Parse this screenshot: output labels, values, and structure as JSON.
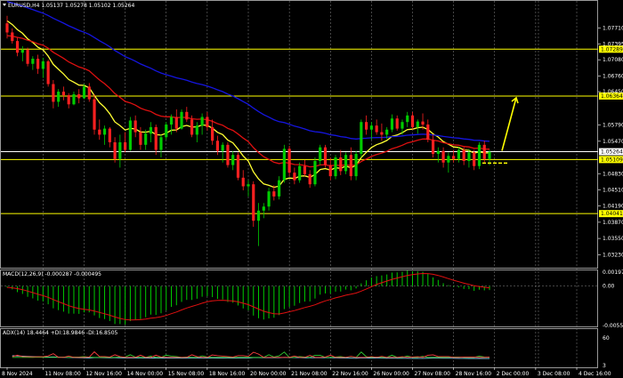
{
  "header": {
    "symbol_line": "EURUSD,H4  1.05137 1.05278 1.05102 1.05264"
  },
  "price_axis": [
    {
      "value": 1.0771,
      "label": "1.07710"
    },
    {
      "value": 1.07395,
      "label": "1.07395"
    },
    {
      "value": 1.0708,
      "label": "1.07080"
    },
    {
      "value": 1.0676,
      "label": "1.06760"
    },
    {
      "value": 1.0645,
      "label": "1.06450"
    },
    {
      "value": 1.0579,
      "label": "1.05790"
    },
    {
      "value": 1.0547,
      "label": "1.05470"
    },
    {
      "value": 1.0483,
      "label": "1.04830"
    },
    {
      "value": 1.0451,
      "label": "1.04510"
    },
    {
      "value": 1.0419,
      "label": "1.04190"
    },
    {
      "value": 1.0387,
      "label": "1.03870"
    },
    {
      "value": 1.0355,
      "label": "1.03550"
    },
    {
      "value": 1.0323,
      "label": "1.03230"
    }
  ],
  "levels": [
    {
      "value": 1.07289,
      "label": "1.07289",
      "color": "#ffff00"
    },
    {
      "value": 1.06364,
      "label": "1.06364",
      "color": "#ffff00"
    },
    {
      "value": 1.05264,
      "label": "1.05264",
      "color": "#ffffff"
    },
    {
      "value": 1.05109,
      "label": "1.05109",
      "color": "#ffff00"
    },
    {
      "value": 1.04041,
      "label": "1.04041",
      "color": "#ffff00"
    }
  ],
  "time_axis": [
    {
      "label": "8 Nov 2024",
      "x_index": 0
    },
    {
      "label": "11 Nov 08:00",
      "x_index": 7
    },
    {
      "label": "12 Nov 16:00",
      "x_index": 15
    },
    {
      "label": "14 Nov 00:00",
      "x_index": 23
    },
    {
      "label": "15 Nov 08:00",
      "x_index": 31
    },
    {
      "label": "18 Nov 16:00",
      "x_index": 39
    },
    {
      "label": "20 Nov 00:00",
      "x_index": 47
    },
    {
      "label": "21 Nov 08:00",
      "x_index": 55
    },
    {
      "label": "22 Nov 16:00",
      "x_index": 63
    },
    {
      "label": "26 Nov 00:00",
      "x_index": 71
    },
    {
      "label": "27 Nov 08:00",
      "x_index": 79
    },
    {
      "label": "28 Nov 16:00",
      "x_index": 87
    },
    {
      "label": "2 Dec 00:00",
      "x_index": 95
    },
    {
      "label": "3 Dec 08:00",
      "x_index": 103
    },
    {
      "label": "4 Dec 16:00",
      "x_index": 111
    }
  ],
  "macd": {
    "label": "MACD(12,26,9) -0.000287 -0.000495",
    "axis": [
      {
        "value": 0.001972,
        "label": "0.001972"
      },
      {
        "value": 0,
        "label": "0.00"
      },
      {
        "value": -0.005579,
        "label": "-0.005579"
      }
    ]
  },
  "adx": {
    "label": "ADX(14) 18.4464 +DI:18.9846 -DI:16.8505",
    "axis": [
      {
        "value": 60,
        "label": "60"
      },
      {
        "value": 3,
        "label": "3"
      }
    ]
  },
  "colors": {
    "bull": "#00cc00",
    "bear": "#ff2020",
    "ma_fast": "#ffff33",
    "ma_mid": "#e01010",
    "ma_slow": "#1515e0",
    "level": "#ffff00",
    "arrow": "#ffff00",
    "grid": "#8a8a8a"
  },
  "chart_data": {
    "type": "candlestick",
    "symbol": "EURUSD",
    "timeframe": "H4",
    "ylim": [
      1.0313,
      1.0805
    ],
    "candles": [
      [
        1.078,
        1.0795,
        1.075,
        1.0762
      ],
      [
        1.0762,
        1.077,
        1.074,
        1.0745
      ],
      [
        1.0745,
        1.0752,
        1.0715,
        1.0722
      ],
      [
        1.0722,
        1.0735,
        1.0705,
        1.0728
      ],
      [
        1.0728,
        1.0732,
        1.0695,
        1.07
      ],
      [
        1.07,
        1.0715,
        1.0688,
        1.071
      ],
      [
        1.071,
        1.0718,
        1.068,
        1.069
      ],
      [
        1.069,
        1.0712,
        1.0672,
        1.0705
      ],
      [
        1.0705,
        1.0708,
        1.0655,
        1.066
      ],
      [
        1.066,
        1.0668,
        1.0612,
        1.0625
      ],
      [
        1.0625,
        1.065,
        1.0615,
        1.0645
      ],
      [
        1.0645,
        1.0655,
        1.0628,
        1.0638
      ],
      [
        1.0638,
        1.0642,
        1.0612,
        1.062
      ],
      [
        1.062,
        1.0645,
        1.0618,
        1.064
      ],
      [
        1.064,
        1.065,
        1.0622,
        1.0632
      ],
      [
        1.0632,
        1.066,
        1.063,
        1.0655
      ],
      [
        1.0655,
        1.0662,
        1.0625,
        1.063
      ],
      [
        1.063,
        1.064,
        1.056,
        1.057
      ],
      [
        1.057,
        1.059,
        1.055,
        1.056
      ],
      [
        1.056,
        1.0578,
        1.054,
        1.0572
      ],
      [
        1.0572,
        1.0575,
        1.0535,
        1.0545
      ],
      [
        1.0545,
        1.0555,
        1.0505,
        1.0512
      ],
      [
        1.0512,
        1.056,
        1.0495,
        1.0545
      ],
      [
        1.0545,
        1.0565,
        1.0525,
        1.053
      ],
      [
        1.053,
        1.0595,
        1.0528,
        1.0588
      ],
      [
        1.0588,
        1.0598,
        1.0555,
        1.0565
      ],
      [
        1.0565,
        1.0575,
        1.053,
        1.054
      ],
      [
        1.054,
        1.057,
        1.053,
        1.0562
      ],
      [
        1.0562,
        1.0585,
        1.0545,
        1.0575
      ],
      [
        1.0575,
        1.058,
        1.052,
        1.053
      ],
      [
        1.053,
        1.056,
        1.0515,
        1.0555
      ],
      [
        1.0555,
        1.0585,
        1.055,
        1.058
      ],
      [
        1.058,
        1.06,
        1.056,
        1.0595
      ],
      [
        1.0595,
        1.061,
        1.0565,
        1.0572
      ],
      [
        1.0572,
        1.061,
        1.057,
        1.0605
      ],
      [
        1.0605,
        1.0615,
        1.0585,
        1.059
      ],
      [
        1.059,
        1.0598,
        1.0555,
        1.056
      ],
      [
        1.056,
        1.0585,
        1.0545,
        1.0578
      ],
      [
        1.0578,
        1.0602,
        1.056,
        1.0595
      ],
      [
        1.0595,
        1.0605,
        1.0568,
        1.0575
      ],
      [
        1.0575,
        1.059,
        1.054,
        1.0548
      ],
      [
        1.0548,
        1.0558,
        1.052,
        1.0528
      ],
      [
        1.0528,
        1.0545,
        1.0505,
        1.054
      ],
      [
        1.054,
        1.0545,
        1.0495,
        1.05
      ],
      [
        1.05,
        1.0528,
        1.049,
        1.052
      ],
      [
        1.052,
        1.0525,
        1.047,
        1.0475
      ],
      [
        1.0475,
        1.049,
        1.045,
        1.0458
      ],
      [
        1.0458,
        1.047,
        1.0438,
        1.0462
      ],
      [
        1.0462,
        1.0468,
        1.0378,
        1.039
      ],
      [
        1.039,
        1.0425,
        1.034,
        1.041
      ],
      [
        1.041,
        1.0425,
        1.0395,
        1.0418
      ],
      [
        1.0418,
        1.0455,
        1.041,
        1.0448
      ],
      [
        1.0448,
        1.046,
        1.043,
        1.0438
      ],
      [
        1.0438,
        1.0478,
        1.0432,
        1.047
      ],
      [
        1.047,
        1.054,
        1.0465,
        1.0532
      ],
      [
        1.0532,
        1.0538,
        1.0478,
        1.0485
      ],
      [
        1.0485,
        1.0495,
        1.0462,
        1.047
      ],
      [
        1.047,
        1.0505,
        1.0465,
        1.0498
      ],
      [
        1.0498,
        1.051,
        1.0478,
        1.0482
      ],
      [
        1.0482,
        1.049,
        1.0455,
        1.0462
      ],
      [
        1.0462,
        1.0515,
        1.0458,
        1.0508
      ],
      [
        1.0508,
        1.054,
        1.05,
        1.0535
      ],
      [
        1.0535,
        1.054,
        1.0495,
        1.05
      ],
      [
        1.05,
        1.0515,
        1.047,
        1.0478
      ],
      [
        1.0478,
        1.052,
        1.0472,
        1.0515
      ],
      [
        1.0515,
        1.053,
        1.048,
        1.0488
      ],
      [
        1.0488,
        1.0525,
        1.0482,
        1.052
      ],
      [
        1.052,
        1.0535,
        1.047,
        1.0478
      ],
      [
        1.0478,
        1.0528,
        1.047,
        1.0522
      ],
      [
        1.0522,
        1.059,
        1.0515,
        1.0585
      ],
      [
        1.0585,
        1.0598,
        1.056,
        1.057
      ],
      [
        1.057,
        1.0585,
        1.055,
        1.0578
      ],
      [
        1.0578,
        1.059,
        1.056,
        1.0565
      ],
      [
        1.0565,
        1.0582,
        1.0548,
        1.056
      ],
      [
        1.056,
        1.0575,
        1.0552,
        1.057
      ],
      [
        1.057,
        1.06,
        1.0565,
        1.0592
      ],
      [
        1.0592,
        1.0598,
        1.0568,
        1.0572
      ],
      [
        1.0572,
        1.059,
        1.056,
        1.0585
      ],
      [
        1.0585,
        1.0605,
        1.0575,
        1.0598
      ],
      [
        1.0598,
        1.0605,
        1.057,
        1.0575
      ],
      [
        1.0575,
        1.059,
        1.0562,
        1.0586
      ],
      [
        1.0586,
        1.0602,
        1.057,
        1.058
      ],
      [
        1.058,
        1.059,
        1.0545,
        1.055
      ],
      [
        1.055,
        1.056,
        1.0515,
        1.0522
      ],
      [
        1.0522,
        1.0535,
        1.0505,
        1.0528
      ],
      [
        1.0528,
        1.0535,
        1.0495,
        1.0505
      ],
      [
        1.0505,
        1.0525,
        1.0485,
        1.0518
      ],
      [
        1.0518,
        1.053,
        1.0505,
        1.0512
      ],
      [
        1.0512,
        1.0535,
        1.0505,
        1.053
      ],
      [
        1.053,
        1.0535,
        1.05,
        1.0508
      ],
      [
        1.0508,
        1.0532,
        1.0495,
        1.0525
      ],
      [
        1.0525,
        1.053,
        1.049,
        1.0498
      ],
      [
        1.0498,
        1.0545,
        1.0492,
        1.054
      ],
      [
        1.054,
        1.0548,
        1.0505,
        1.0512
      ],
      [
        1.0512,
        1.053,
        1.05,
        1.0526
      ]
    ]
  }
}
